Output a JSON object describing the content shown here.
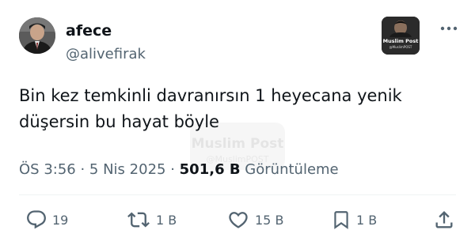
{
  "author": {
    "name": "afece",
    "handle": "@alivefirak"
  },
  "brand": {
    "logo_label": "Muslim Post",
    "logo_sub": "@MuslimPOST"
  },
  "tweet": {
    "lines": [
      "Bin kez temkinli davranırsın 1 heyecana yenik",
      "düşersin bu hayat böyle"
    ]
  },
  "watermark": {
    "line1": "Muslim Post",
    "line2": "@MuslimPOST"
  },
  "meta": {
    "time": "ÖS 3:56",
    "sep1": " · ",
    "date": "5 Nis 2025",
    "sep2": " · ",
    "views": "501,6 B",
    "views_label": " Görüntüleme"
  },
  "actions": {
    "replies": "19",
    "reposts": "1 B",
    "likes": "15 B",
    "bookmarks": "1 B"
  },
  "icons": {
    "reply": "comment-icon",
    "repost": "repost-icon",
    "like": "heart-icon",
    "bookmark": "bookmark-icon",
    "share": "share-icon",
    "more": "more-icon"
  },
  "colors": {
    "text": "#0f1419",
    "secondary": "#536471",
    "divider": "#eff3f4"
  }
}
